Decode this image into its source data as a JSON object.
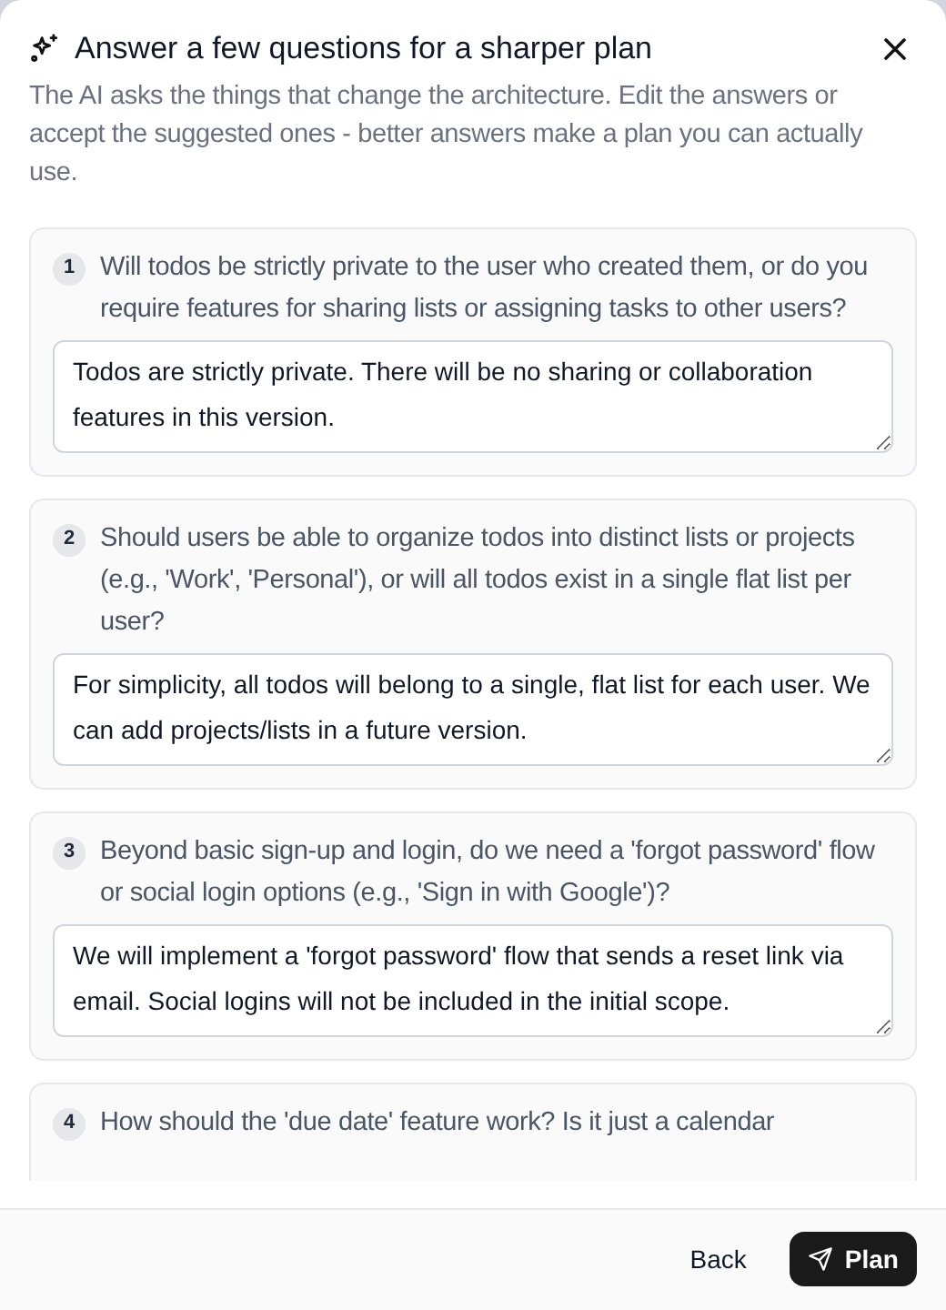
{
  "dialog": {
    "title": "Answer a few questions for a sharper plan",
    "description": "The AI asks the things that change the architecture. Edit the answers or accept the suggested ones - better answers make a plan you can actually use."
  },
  "questions": [
    {
      "number": "1",
      "question": "Will todos be strictly private to the user who created them, or do you require features for sharing lists or assigning tasks to other users?",
      "answer": "Todos are strictly private. There will be no sharing or collaboration features in this version."
    },
    {
      "number": "2",
      "question": "Should users be able to organize todos into distinct lists or projects (e.g., 'Work', 'Personal'), or will all todos exist in a single flat list per user?",
      "answer": "For simplicity, all todos will belong to a single, flat list for each user. We can add projects/lists in a future version."
    },
    {
      "number": "3",
      "question": "Beyond basic sign-up and login, do we need a 'forgot password' flow or social login options (e.g., 'Sign in with Google')?",
      "answer": "We will implement a 'forgot password' flow that sends a reset link via email. Social logins will not be included in the initial scope."
    },
    {
      "number": "4",
      "question": "How should the 'due date' feature work? Is it just a calendar"
    }
  ],
  "footer": {
    "buttons": [
      {
        "label": "Back",
        "kind": "ghost"
      },
      {
        "label": "Plan",
        "kind": "primary"
      }
    ]
  }
}
